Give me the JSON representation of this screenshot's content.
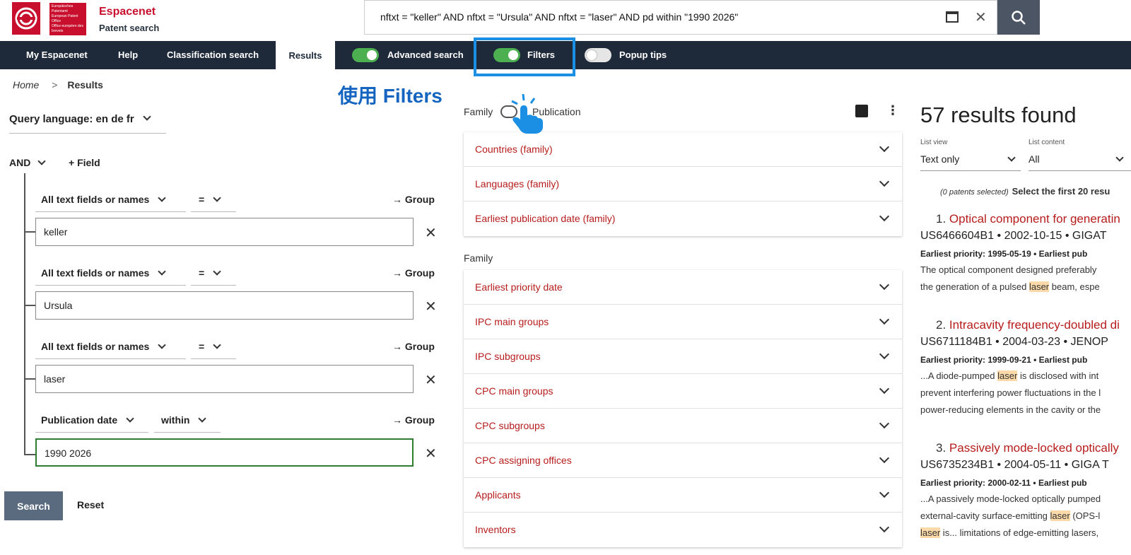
{
  "header": {
    "logo_lines": [
      "Europäisches Patentamt",
      "European Patent Office",
      "Office européen des brevets"
    ],
    "brand_name": "Espacenet",
    "brand_sub": "Patent search",
    "query": "nftxt = \"keller\" AND nftxt = \"Ursula\" AND nftxt = \"laser\" AND pd within \"1990 2026\"",
    "clear": "✕"
  },
  "nav": {
    "my": "My Espacenet",
    "help": "Help",
    "class": "Classification search",
    "results": "Results",
    "advanced": "Advanced search",
    "filters": "Filters",
    "popup": "Popup tips"
  },
  "annotation": "使用 Filters",
  "breadcrumb": {
    "home": "Home",
    "sep": ">",
    "current": "Results"
  },
  "query_panel": {
    "language": "Query language: en de fr",
    "operator": "AND",
    "add_field": "+ Field",
    "group": "→ Group",
    "remove": "✕",
    "rows": [
      {
        "field": "All text fields or names",
        "op": "=",
        "value": "keller"
      },
      {
        "field": "All text fields or names",
        "op": "=",
        "value": "Ursula"
      },
      {
        "field": "All text fields or names",
        "op": "=",
        "value": "laser"
      },
      {
        "field": "Publication date",
        "op": "within",
        "value": "1990 2026"
      }
    ],
    "search": "Search",
    "reset": "Reset"
  },
  "filters": {
    "family_label": "Family",
    "publication_label": "Publication",
    "top_groups": [
      "Countries (family)",
      "Languages (family)",
      "Earliest publication date (family)"
    ],
    "family_heading": "Family",
    "family_groups": [
      "Earliest priority date",
      "IPC main groups",
      "IPC subgroups",
      "CPC main groups",
      "CPC subgroups",
      "CPC assigning offices",
      "Applicants",
      "Inventors"
    ]
  },
  "results": {
    "title": "57 results found",
    "list_view_label": "List view",
    "list_view_value": "Text only",
    "list_content_label": "List content",
    "list_content_value": "All",
    "selected": "(0 patents selected)",
    "select_first": "Select the first 20 resu",
    "items": [
      {
        "num": "1.",
        "title": "Optical component for generatin",
        "meta": "US6466604B1 • 2002-10-15 • GIGAT",
        "prio": "Earliest priority: 1995-05-19 • Earliest pub",
        "l1a": "The optical component designed preferably",
        "l2a": "the generation of a pulsed ",
        "l2m": "laser",
        "l2b": " beam, espe"
      },
      {
        "num": "2.",
        "title": "Intracavity frequency-doubled di",
        "meta": "US6711184B1 • 2004-03-23 • JENOP",
        "prio": "Earliest priority: 1999-09-21 • Earliest pub",
        "l1a": "...A diode-pumped ",
        "l1m": "laser",
        "l1b": " is disclosed with int",
        "l2a": "prevent interfering power fluctuations in the l",
        "l3a": "power-reducing elements in the cavity or the"
      },
      {
        "num": "3.",
        "title": "Passively mode-locked optically",
        "meta": "US6735234B1 • 2004-05-11 • GIGA T",
        "prio": "Earliest priority: 2000-02-11 • Earliest pub",
        "l1a": "...A passively mode-locked optically pumped",
        "l2a": "external-cavity surface-emitting ",
        "l2m": "laser",
        "l2b": " (OPS-l",
        "l3m": "laser",
        "l3b": " is... limitations of edge-emitting lasers,"
      }
    ]
  },
  "colors": {
    "brand_red": "#c8102e",
    "nav_bg": "#1e2a3a",
    "toggle_on": "#4caf50",
    "highlight": "#1a8fe3",
    "link_red": "#b71c1c"
  }
}
